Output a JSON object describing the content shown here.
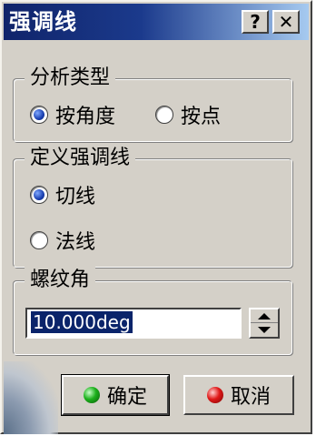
{
  "window": {
    "title": "强调线",
    "help_label": "?",
    "close_label": "✕"
  },
  "analysis_type": {
    "legend": "分析类型",
    "options": [
      {
        "label": "按角度",
        "checked": true
      },
      {
        "label": "按点",
        "checked": false
      }
    ]
  },
  "highlight_def": {
    "legend": "定义强调线",
    "options": [
      {
        "label": "切线",
        "checked": true
      },
      {
        "label": "法线",
        "checked": false
      }
    ]
  },
  "helix_angle": {
    "legend": "螺纹角",
    "value": "10.000deg"
  },
  "buttons": {
    "ok": "确定",
    "cancel": "取消"
  },
  "colors": {
    "title_bar_start": "#10246a",
    "title_bar_end": "#a6caf0",
    "dialog_bg": "#d4d0c8",
    "selection_bg": "#0a246a",
    "ok_icon": "#1bb01b",
    "cancel_icon": "#e01818"
  },
  "icons": {
    "ok": "green-ball-icon",
    "cancel": "red-ball-icon",
    "spin_up": "triangle-up-icon",
    "spin_down": "triangle-down-icon"
  }
}
